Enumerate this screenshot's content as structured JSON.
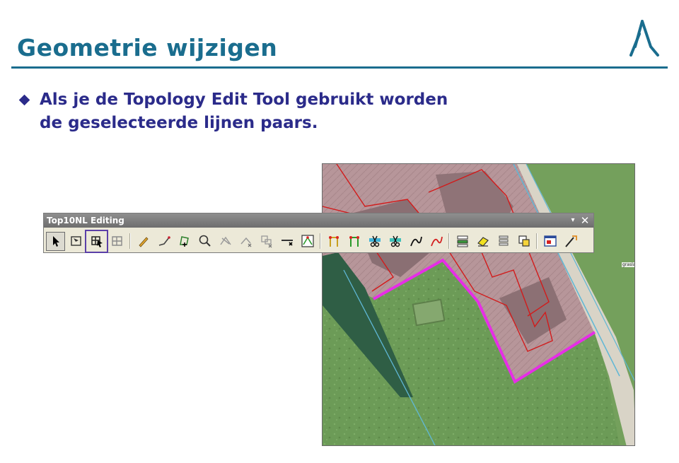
{
  "slide": {
    "title": "Geometrie wijzigen",
    "bullet_line1": "Als je de Topology Edit Tool gebruikt worden",
    "bullet_line2": "de geselecteerde lijnen paars."
  },
  "toolbar": {
    "title": "Top10NL Editing",
    "menu_glyph": "▾",
    "close_glyph": "✕",
    "buttons": [
      {
        "name": "select-arrow-icon",
        "state": "pressed"
      },
      {
        "name": "select-feature-icon"
      },
      {
        "name": "topology-edit-tool-icon",
        "state": "highlighted"
      },
      {
        "name": "topology-edit-icon"
      },
      {
        "name": "separator"
      },
      {
        "name": "sketch-pencil-icon"
      },
      {
        "name": "edit-line-icon"
      },
      {
        "name": "edit-vertices-icon"
      },
      {
        "name": "zoom-magnifier-icon"
      },
      {
        "name": "split-line-icon"
      },
      {
        "name": "reshape-icon"
      },
      {
        "name": "delete-vertex-icon"
      },
      {
        "name": "remove-segment-icon"
      },
      {
        "name": "topology-check-icon"
      },
      {
        "name": "separator"
      },
      {
        "name": "snap-yellow-icon"
      },
      {
        "name": "snap-green-icon"
      },
      {
        "name": "cut-blue-icon"
      },
      {
        "name": "cut-teal-icon"
      },
      {
        "name": "draw-curve-black-icon"
      },
      {
        "name": "draw-curve-red-icon"
      },
      {
        "name": "separator"
      },
      {
        "name": "attributes-list-icon"
      },
      {
        "name": "eraser-icon"
      },
      {
        "name": "stack-layers-icon"
      },
      {
        "name": "copy-features-icon"
      },
      {
        "name": "separator"
      },
      {
        "name": "report-window-icon"
      },
      {
        "name": "wizard-icon"
      }
    ]
  },
  "map": {
    "label": "grasla",
    "colors": {
      "grass": "#6c9b57",
      "building_area": "#b7969a",
      "selected_lines": "#e62ee6",
      "building_outline": "#d21b1b",
      "water": "#2f5e45",
      "road": "#d9d4c7"
    }
  },
  "colors": {
    "title": "#1a6d8e",
    "bullet_text": "#2b2b8a",
    "highlight_box": "#5b3fa8"
  }
}
